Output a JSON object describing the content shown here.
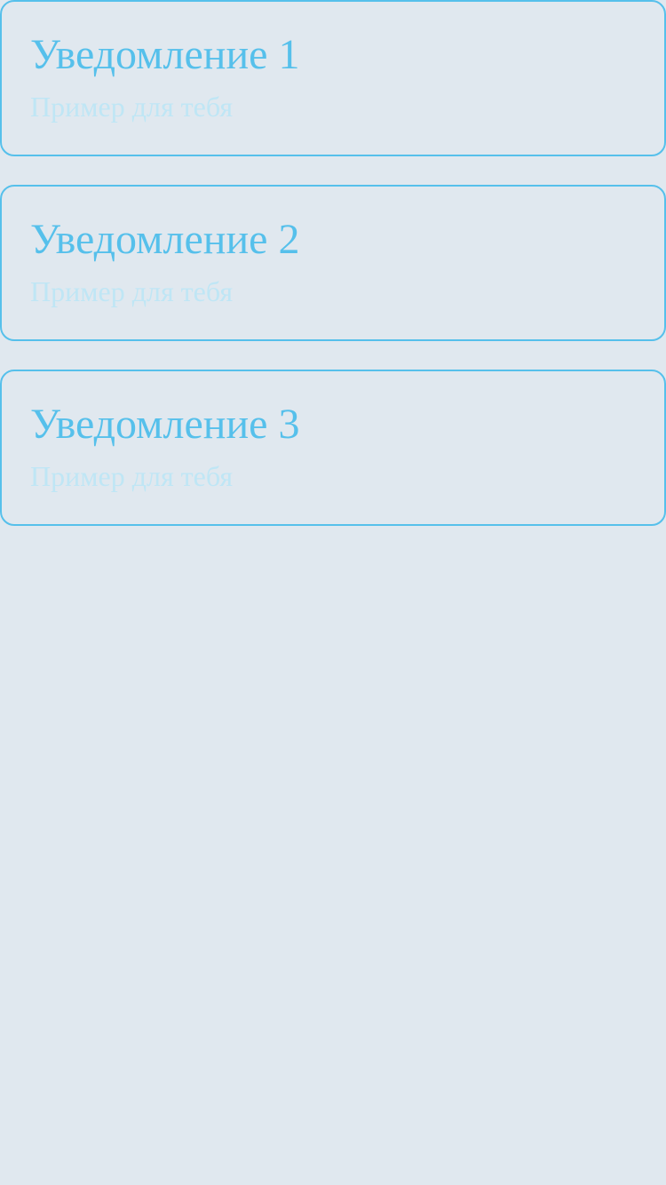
{
  "colors": {
    "background": "#e0e8ef",
    "accent": "#56c0eb",
    "muted_text": "#bfe6f5"
  },
  "notifications": [
    {
      "title": "Уведомление 1",
      "subtitle": "Пример для тебя"
    },
    {
      "title": "Уведомление 2",
      "subtitle": "Пример для тебя"
    },
    {
      "title": "Уведомление 3",
      "subtitle": "Пример для тебя"
    }
  ]
}
